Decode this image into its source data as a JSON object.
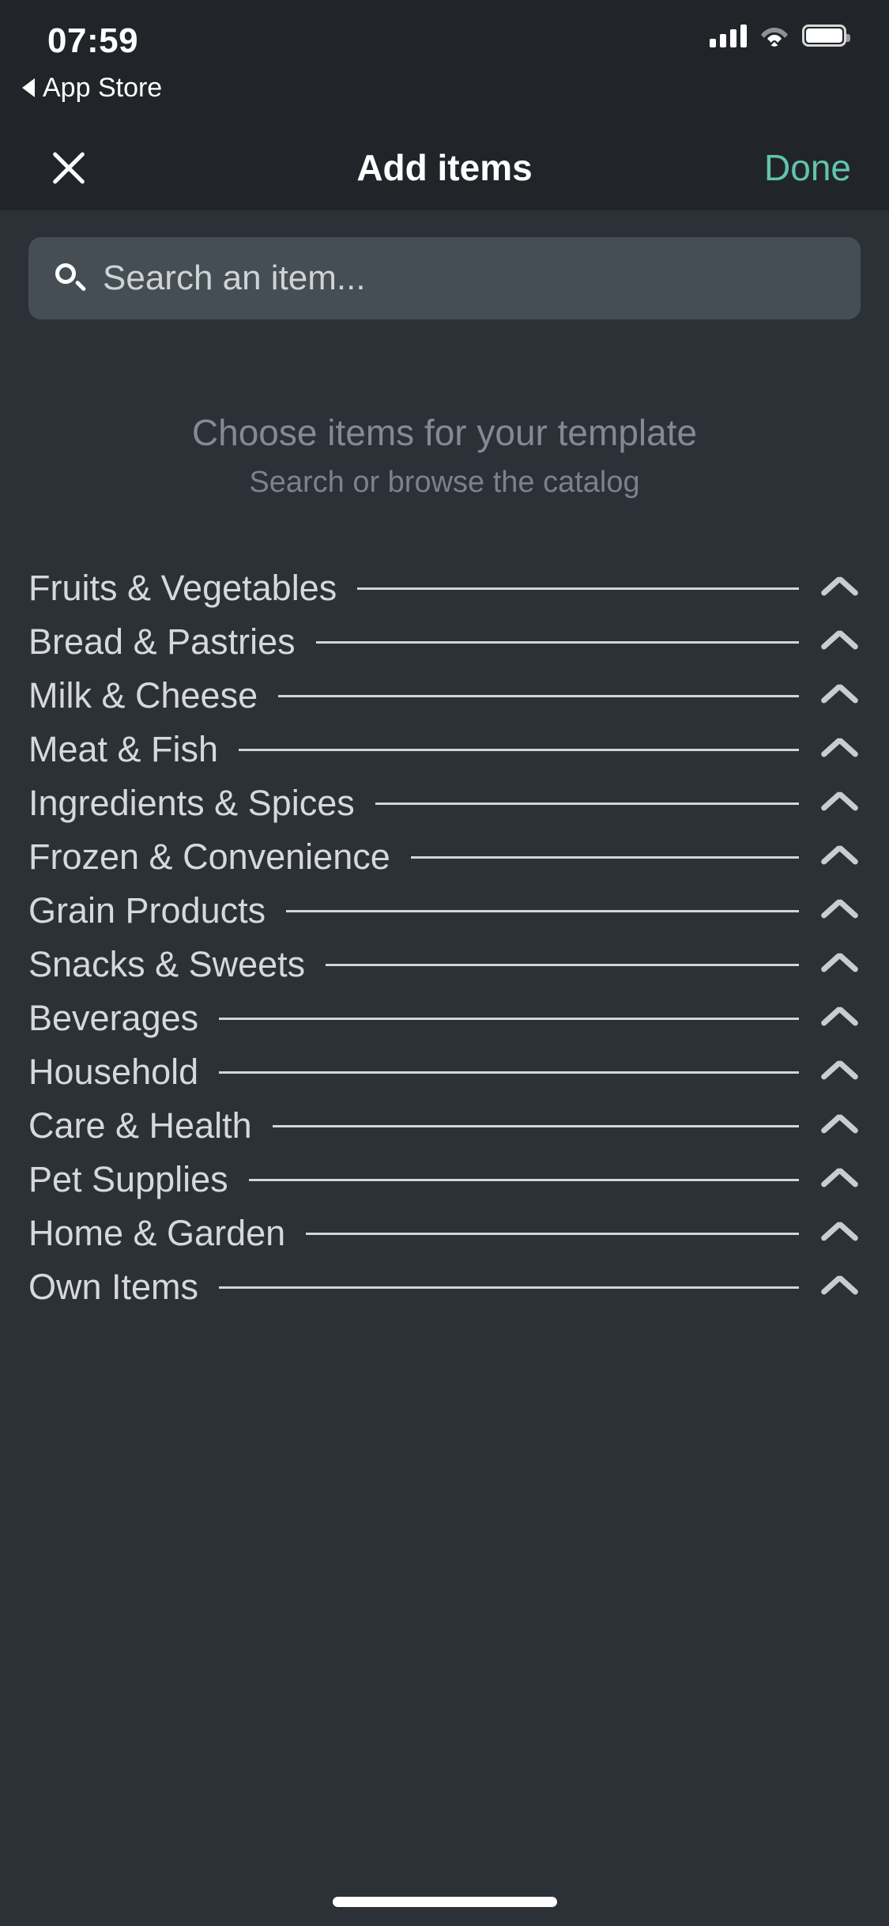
{
  "status_bar": {
    "time": "07:59",
    "back_label": "App Store",
    "icons": [
      "cellular-signal-icon",
      "wifi-icon",
      "battery-icon"
    ]
  },
  "nav_bar": {
    "close_icon": "close-icon",
    "title": "Add items",
    "done_label": "Done",
    "done_color": "#62c3ae"
  },
  "search": {
    "icon": "search-icon",
    "value": "",
    "placeholder": "Search an item..."
  },
  "empty_state": {
    "title": "Choose items for your template",
    "subtitle": "Search or browse the catalog"
  },
  "categories": [
    {
      "label": "Fruits & Vegetables",
      "chevron": "chevron-up-icon"
    },
    {
      "label": "Bread & Pastries",
      "chevron": "chevron-up-icon"
    },
    {
      "label": "Milk & Cheese",
      "chevron": "chevron-up-icon"
    },
    {
      "label": "Meat & Fish",
      "chevron": "chevron-up-icon"
    },
    {
      "label": "Ingredients & Spices",
      "chevron": "chevron-up-icon"
    },
    {
      "label": "Frozen & Convenience",
      "chevron": "chevron-up-icon"
    },
    {
      "label": "Grain Products",
      "chevron": "chevron-up-icon"
    },
    {
      "label": "Snacks & Sweets",
      "chevron": "chevron-up-icon"
    },
    {
      "label": "Beverages",
      "chevron": "chevron-up-icon"
    },
    {
      "label": "Household",
      "chevron": "chevron-up-icon"
    },
    {
      "label": "Care & Health",
      "chevron": "chevron-up-icon"
    },
    {
      "label": "Pet Supplies",
      "chevron": "chevron-up-icon"
    },
    {
      "label": "Home & Garden",
      "chevron": "chevron-up-icon"
    },
    {
      "label": "Own Items",
      "chevron": "chevron-up-icon"
    }
  ],
  "theme": {
    "header_background": "#212529",
    "body_background": "#2c3037",
    "search_background": "#454e54",
    "accent": "#62c3ae",
    "text_primary": "#d6d9db",
    "text_muted": "#838a95"
  }
}
